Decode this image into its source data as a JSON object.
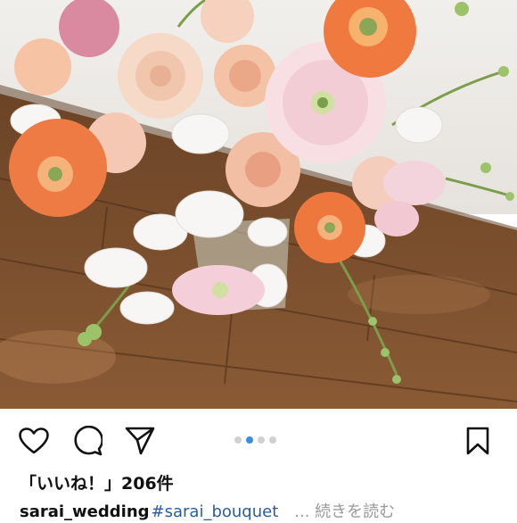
{
  "post": {
    "image": {
      "description_icon": "photo",
      "slides_total": 4,
      "slide_active_index": 1
    },
    "actions": {
      "like_icon": "heart-icon",
      "comment_icon": "comment-icon",
      "share_icon": "send-icon",
      "save_icon": "bookmark-icon"
    },
    "likes_text": "「いいね！」206件",
    "caption": {
      "username": "sarai_wedding",
      "hashtag": "#sarai_bouquet",
      "more_label": "... 続きを読む"
    },
    "colors": {
      "accent_dot": "#3a8ee8",
      "inactive_dot": "#d0d0d0",
      "hashtag": "#2b5d9c",
      "muted": "#9a9a9a"
    }
  }
}
